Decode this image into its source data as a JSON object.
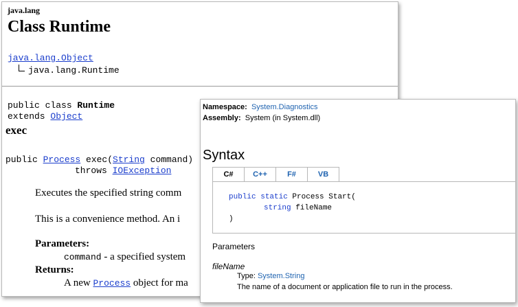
{
  "java_doc": {
    "package": "java.lang",
    "title": "Class Runtime",
    "hierarchy_parent": "java.lang.Object",
    "hierarchy_child": "java.lang.Runtime",
    "decl_prefix": "public class ",
    "decl_class": "Runtime",
    "decl_extends": "extends ",
    "decl_superclass": "Object",
    "method_name_heading": "exec",
    "sig_prefix": "public ",
    "sig_return_type": "Process",
    "sig_method": " exec(",
    "sig_param_type": "String",
    "sig_param_rest": " command)",
    "sig_throws": "throws ",
    "sig_exception": "IOException",
    "description_1": "Executes the specified string comm",
    "description_2": "This is a convenience method. An i",
    "parameters_heading": "Parameters:",
    "param_name": "command",
    "param_desc": " - a specified system",
    "returns_heading": "Returns:",
    "returns_prefix": "A new ",
    "returns_type": "Process",
    "returns_rest": " object for ma"
  },
  "net_doc": {
    "namespace_label": "Namespace:",
    "namespace_value": "System.Diagnostics",
    "assembly_label": "Assembly:",
    "assembly_value": "System (in System.dll)",
    "syntax_heading": "Syntax",
    "tabs": [
      "C#",
      "C++",
      "F#",
      "VB"
    ],
    "active_tab": "C#",
    "code": {
      "kw_public": "public",
      "kw_static": "static",
      "line1_rest": " Process Start(",
      "kw_string": "string",
      "line2_rest": " fileName",
      "line3": ")"
    },
    "parameters_heading": "Parameters",
    "param_name": "fileName",
    "type_label": "Type: ",
    "type_value": "System.String",
    "param_description": "The name of a document or application file to run in the process."
  }
}
